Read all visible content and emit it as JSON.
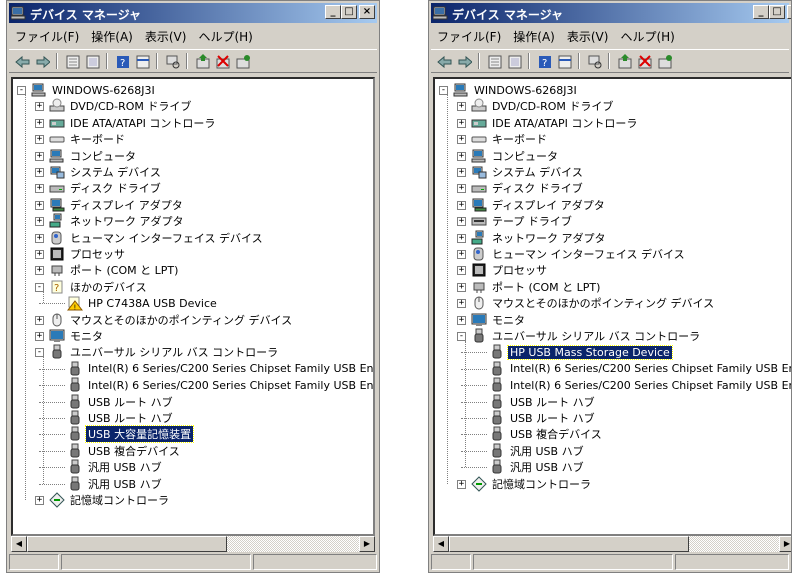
{
  "title": "デバイス マネージャ",
  "controls": {
    "minimize": "_",
    "maximize": "□",
    "close": "×"
  },
  "menu": [
    "ファイル(F)",
    "操作(A)",
    "表示(V)",
    "ヘルプ(H)"
  ],
  "toolbar_icons": [
    "back-icon",
    "forward-icon",
    "properties-icon",
    "show-hide-icon",
    "help-icon",
    "view-icon",
    "scan-icon",
    "update-driver-icon",
    "uninstall-icon",
    "enable-icon"
  ],
  "colors": {
    "titlebar_start": "#0a246a",
    "titlebar_end": "#a6caf0",
    "selection": "#0a246a",
    "chrome": "#d4d0c8"
  },
  "left_tree": [
    {
      "label": "WINDOWS-6268J3I",
      "depth": 0,
      "icon": "computer-icon",
      "exp": "-"
    },
    {
      "label": "DVD/CD-ROM ドライブ",
      "depth": 1,
      "icon": "dvd-drive-icon",
      "exp": "+"
    },
    {
      "label": "IDE ATA/ATAPI コントローラ",
      "depth": 1,
      "icon": "ide-controller-icon",
      "exp": "+"
    },
    {
      "label": "キーボード",
      "depth": 1,
      "icon": "keyboard-icon",
      "exp": "+"
    },
    {
      "label": "コンピュータ",
      "depth": 1,
      "icon": "computer-icon",
      "exp": "+"
    },
    {
      "label": "システム デバイス",
      "depth": 1,
      "icon": "system-device-icon",
      "exp": "+"
    },
    {
      "label": "ディスク ドライブ",
      "depth": 1,
      "icon": "disk-drive-icon",
      "exp": "+"
    },
    {
      "label": "ディスプレイ アダプタ",
      "depth": 1,
      "icon": "display-adapter-icon",
      "exp": "+"
    },
    {
      "label": "ネットワーク アダプタ",
      "depth": 1,
      "icon": "network-adapter-icon",
      "exp": "+"
    },
    {
      "label": "ヒューマン インターフェイス デバイス",
      "depth": 1,
      "icon": "hid-icon",
      "exp": "+"
    },
    {
      "label": "プロセッサ",
      "depth": 1,
      "icon": "processor-icon",
      "exp": "+"
    },
    {
      "label": "ポート (COM と LPT)",
      "depth": 1,
      "icon": "port-icon",
      "exp": "+"
    },
    {
      "label": "ほかのデバイス",
      "depth": 1,
      "icon": "other-devices-icon",
      "exp": "-"
    },
    {
      "label": "HP C7438A USB Device",
      "depth": 2,
      "icon": "unknown-device-warning-icon",
      "exp": ""
    },
    {
      "label": "マウスとそのほかのポインティング デバイス",
      "depth": 1,
      "icon": "mouse-icon",
      "exp": "+"
    },
    {
      "label": "モニタ",
      "depth": 1,
      "icon": "monitor-icon",
      "exp": "+"
    },
    {
      "label": "ユニバーサル シリアル バス コントローラ",
      "depth": 1,
      "icon": "usb-icon",
      "exp": "-"
    },
    {
      "label": "Intel(R) 6 Series/C200 Series Chipset Family USB Enhanced Host Controller",
      "depth": 2,
      "icon": "usb-icon",
      "exp": ""
    },
    {
      "label": "Intel(R) 6 Series/C200 Series Chipset Family USB Enhanced Host Controller",
      "depth": 2,
      "icon": "usb-icon",
      "exp": ""
    },
    {
      "label": "USB ルート ハブ",
      "depth": 2,
      "icon": "usb-icon",
      "exp": ""
    },
    {
      "label": "USB ルート ハブ",
      "depth": 2,
      "icon": "usb-icon",
      "exp": ""
    },
    {
      "label": "USB 大容量記憶装置",
      "depth": 2,
      "icon": "usb-icon",
      "exp": "",
      "selected": true
    },
    {
      "label": "USB 複合デバイス",
      "depth": 2,
      "icon": "usb-icon",
      "exp": ""
    },
    {
      "label": "汎用 USB ハブ",
      "depth": 2,
      "icon": "usb-icon",
      "exp": ""
    },
    {
      "label": "汎用 USB ハブ",
      "depth": 2,
      "icon": "usb-icon",
      "exp": ""
    },
    {
      "label": "記憶域コントローラ",
      "depth": 1,
      "icon": "storage-controller-icon",
      "exp": "+"
    }
  ],
  "right_tree": [
    {
      "label": "WINDOWS-6268J3I",
      "depth": 0,
      "icon": "computer-icon",
      "exp": "-"
    },
    {
      "label": "DVD/CD-ROM ドライブ",
      "depth": 1,
      "icon": "dvd-drive-icon",
      "exp": "+"
    },
    {
      "label": "IDE ATA/ATAPI コントローラ",
      "depth": 1,
      "icon": "ide-controller-icon",
      "exp": "+"
    },
    {
      "label": "キーボード",
      "depth": 1,
      "icon": "keyboard-icon",
      "exp": "+"
    },
    {
      "label": "コンピュータ",
      "depth": 1,
      "icon": "computer-icon",
      "exp": "+"
    },
    {
      "label": "システム デバイス",
      "depth": 1,
      "icon": "system-device-icon",
      "exp": "+"
    },
    {
      "label": "ディスク ドライブ",
      "depth": 1,
      "icon": "disk-drive-icon",
      "exp": "+"
    },
    {
      "label": "ディスプレイ アダプタ",
      "depth": 1,
      "icon": "display-adapter-icon",
      "exp": "+"
    },
    {
      "label": "テープ ドライブ",
      "depth": 1,
      "icon": "tape-drive-icon",
      "exp": "+"
    },
    {
      "label": "ネットワーク アダプタ",
      "depth": 1,
      "icon": "network-adapter-icon",
      "exp": "+"
    },
    {
      "label": "ヒューマン インターフェイス デバイス",
      "depth": 1,
      "icon": "hid-icon",
      "exp": "+"
    },
    {
      "label": "プロセッサ",
      "depth": 1,
      "icon": "processor-icon",
      "exp": "+"
    },
    {
      "label": "ポート (COM と LPT)",
      "depth": 1,
      "icon": "port-icon",
      "exp": "+"
    },
    {
      "label": "マウスとそのほかのポインティング デバイス",
      "depth": 1,
      "icon": "mouse-icon",
      "exp": "+"
    },
    {
      "label": "モニタ",
      "depth": 1,
      "icon": "monitor-icon",
      "exp": "+"
    },
    {
      "label": "ユニバーサル シリアル バス コントローラ",
      "depth": 1,
      "icon": "usb-icon",
      "exp": "-"
    },
    {
      "label": "HP USB Mass Storage Device",
      "depth": 2,
      "icon": "usb-icon",
      "exp": "",
      "selected": true
    },
    {
      "label": "Intel(R) 6 Series/C200 Series Chipset Family USB Enhanced Host Controller",
      "depth": 2,
      "icon": "usb-icon",
      "exp": ""
    },
    {
      "label": "Intel(R) 6 Series/C200 Series Chipset Family USB Enhanced Host Controller",
      "depth": 2,
      "icon": "usb-icon",
      "exp": ""
    },
    {
      "label": "USB ルート ハブ",
      "depth": 2,
      "icon": "usb-icon",
      "exp": ""
    },
    {
      "label": "USB ルート ハブ",
      "depth": 2,
      "icon": "usb-icon",
      "exp": ""
    },
    {
      "label": "USB 複合デバイス",
      "depth": 2,
      "icon": "usb-icon",
      "exp": ""
    },
    {
      "label": "汎用 USB ハブ",
      "depth": 2,
      "icon": "usb-icon",
      "exp": ""
    },
    {
      "label": "汎用 USB ハブ",
      "depth": 2,
      "icon": "usb-icon",
      "exp": ""
    },
    {
      "label": "記憶域コントローラ",
      "depth": 1,
      "icon": "storage-controller-icon",
      "exp": "+"
    }
  ]
}
